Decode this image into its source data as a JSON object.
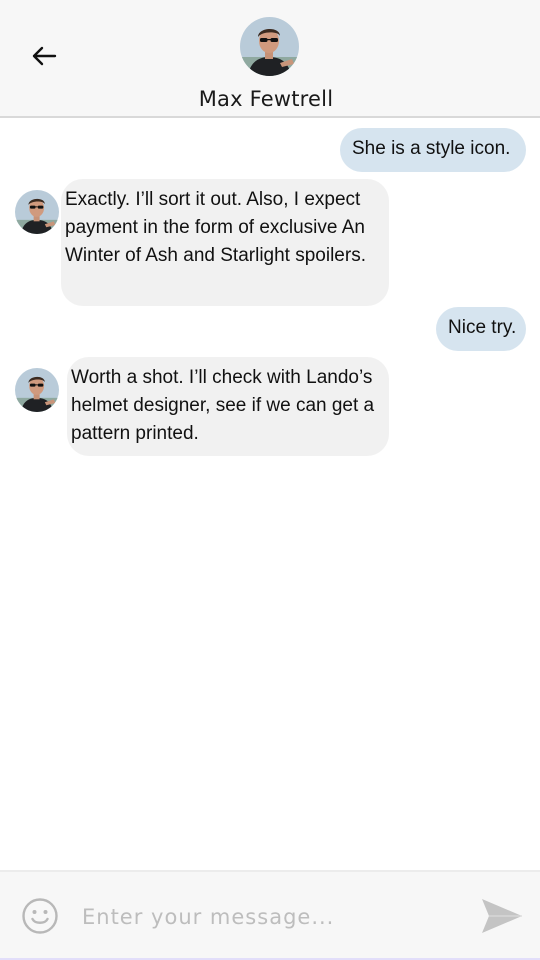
{
  "header": {
    "contact_name": "Max Fewtrell"
  },
  "messages": [
    {
      "direction": "outgoing",
      "text": "She is a style icon."
    },
    {
      "direction": "incoming",
      "text": "Exactly. I’ll sort it out. Also, I expect payment in the form of exclusive An Winter of Ash and Starlight spoilers."
    },
    {
      "direction": "outgoing",
      "text": "Nice try."
    },
    {
      "direction": "incoming",
      "text": "Worth a shot. I’ll check with Lando’s helmet designer, see if we can get a pattern printed."
    }
  ],
  "composer": {
    "placeholder": "Enter your message..."
  },
  "icons": {
    "back": "arrow-left-icon",
    "emoji": "smiley-face-icon",
    "send": "paper-plane-icon"
  },
  "colors": {
    "outgoing_bubble": "#d6e4ef",
    "incoming_bubble": "#f1f1f1",
    "header_background": "#f7f7f7"
  }
}
